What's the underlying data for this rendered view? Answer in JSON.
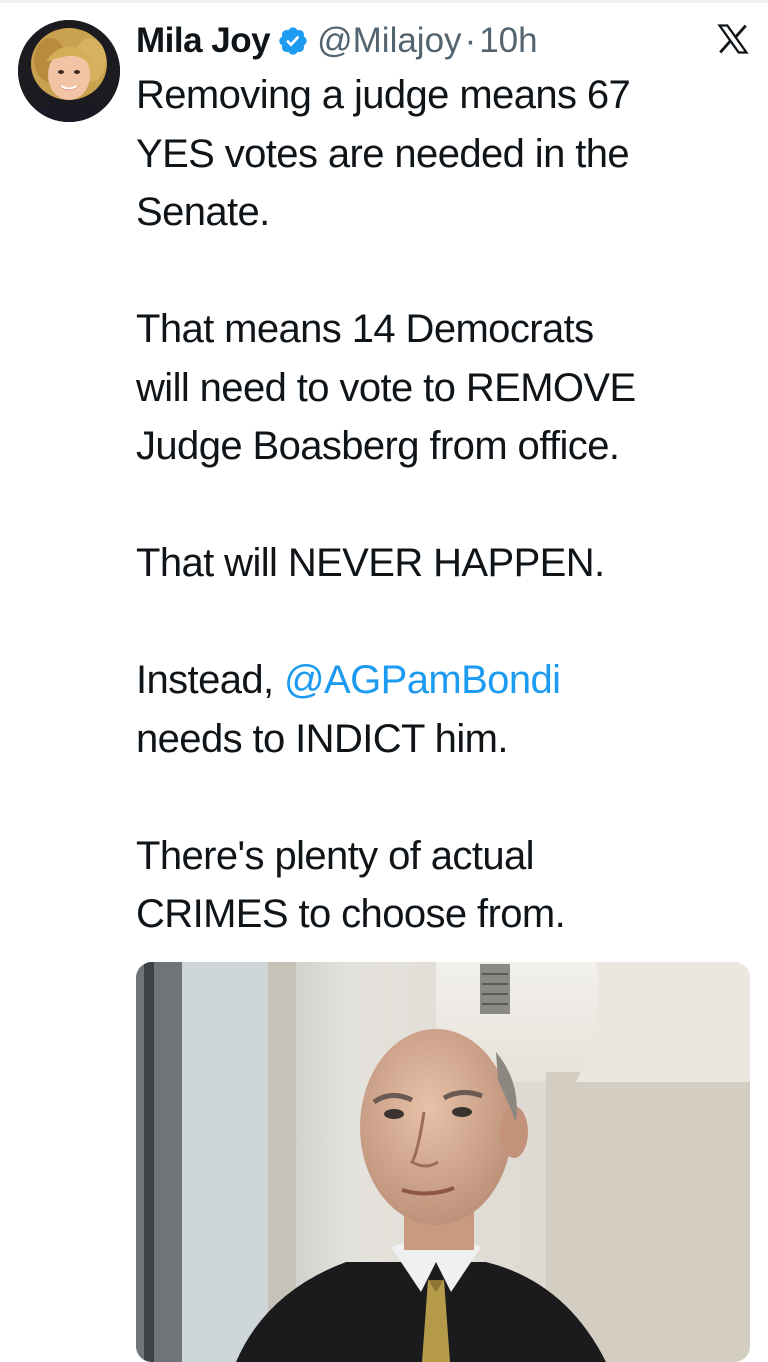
{
  "tweet": {
    "author": {
      "display_name": "Mila Joy",
      "handle": "@Milajoy",
      "verified": true
    },
    "separator": "·",
    "timestamp": "10h",
    "platform_icon": "x-logo-icon",
    "text": {
      "p1_l1": "Removing  a judge means 67",
      "p1_l2": "YES votes are needed in the",
      "p1_l3": "Senate.",
      "p2_l1": "That means 14 Democrats",
      "p2_l2": "will need to vote to REMOVE",
      "p2_l3": "Judge Boasberg from office.",
      "p3_l1": "That will NEVER HAPPEN.",
      "p4_prefix": "Instead, ",
      "p4_mention": "@AGPamBondi",
      "p4_l2": "needs to INDICT him.",
      "p5_l1": "There's plenty of actual",
      "p5_l2": "CRIMES to choose from."
    },
    "colors": {
      "text": "#0f1419",
      "secondary": "#536471",
      "link": "#1d9bf0",
      "verified_badge": "#1d9bf0"
    }
  }
}
